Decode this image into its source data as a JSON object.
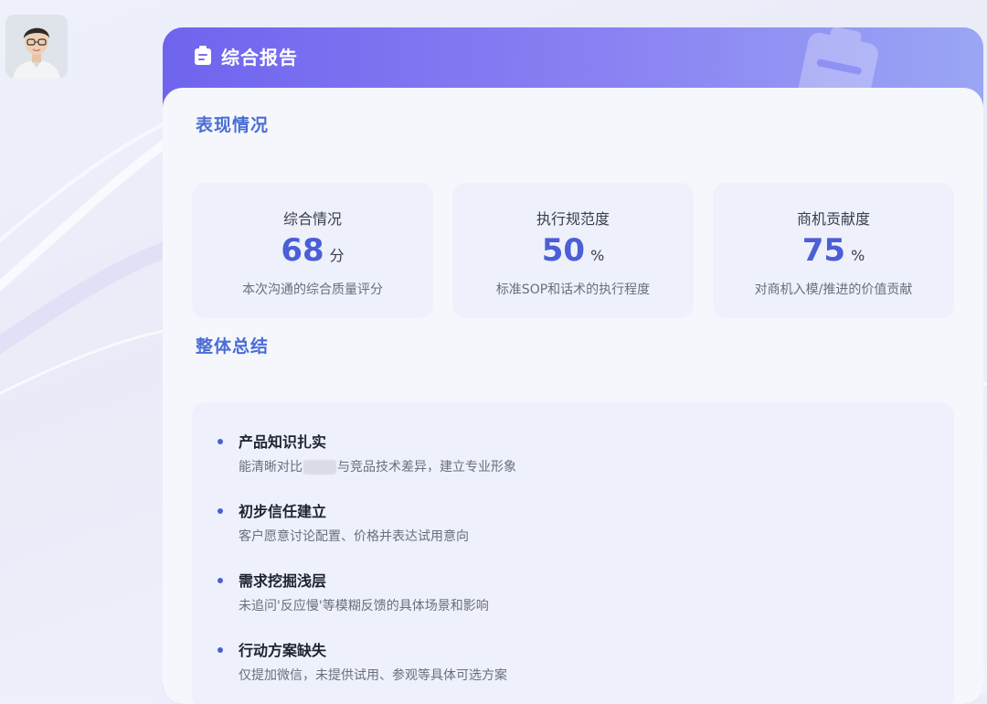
{
  "header": {
    "title": "综合报告"
  },
  "performance": {
    "section_title": "表现情况",
    "metrics": [
      {
        "label": "综合情况",
        "value": "68",
        "unit": "分",
        "desc": "本次沟通的综合质量评分"
      },
      {
        "label": "执行规范度",
        "value": "50",
        "unit": "%",
        "desc": "标准SOP和话术的执行程度"
      },
      {
        "label": "商机贡献度",
        "value": "75",
        "unit": "%",
        "desc": "对商机入模/推进的价值贡献"
      }
    ]
  },
  "summary": {
    "section_title": "整体总结",
    "items": [
      {
        "title": "产品知识扎实",
        "desc_before": "能清晰对比",
        "desc_after": "与竞品技术差异，建立专业形象"
      },
      {
        "title": "初步信任建立",
        "desc": "客户愿意讨论配置、价格并表达试用意向"
      },
      {
        "title": "需求挖掘浅层",
        "desc": "未追问'反应慢'等模糊反馈的具体场景和影响"
      },
      {
        "title": "行动方案缺失",
        "desc": "仅提加微信，未提供试用、参观等具体可选方案"
      }
    ]
  },
  "icons": {
    "header": "clipboard-icon",
    "decoration": "clipboard-watermark-icon"
  },
  "colors": {
    "header_gradient_start": "#6f64ee",
    "header_gradient_end": "#9aa6f4",
    "accent_blue": "#4b5fd6",
    "section_title": "#4a6dd6",
    "card_bg": "#eef1fb"
  }
}
